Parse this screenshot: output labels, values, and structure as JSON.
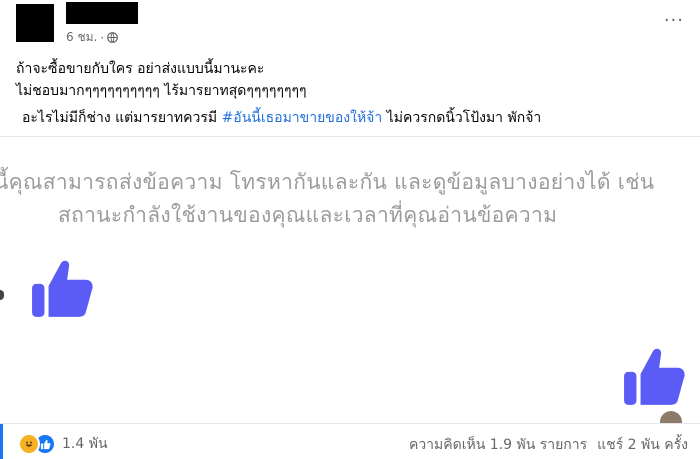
{
  "post": {
    "time": "6 ชม.",
    "separator": "·",
    "lines": {
      "line1": "ถ้าจะซื้อขายกับใคร อย่าส่งแบบนี้มานะคะ",
      "line2": "ไม่ชอบมากๆๆๆๆๆๆๆๆๆๆ ไร้มารยาทสุดๆๆๆๆๆๆๆๆ",
      "line3_before": "อะไรไม่มีก็ช่าง แต่มารยาทควรมี ",
      "line3_hashtag": "#อันนี้เธอมาขายของให้จ้า",
      "line3_after": " ไม่ควรกดนิ้วโป้งมา  พักจ้า"
    },
    "more_label": "···"
  },
  "media": {
    "text_line1": "นี้คุณสามารถส่งข้อความ โทรหากันและกัน และดูข้อมูลบางอย่างได้ เช่น",
    "text_line2": "สถานะกำลังใช้งานของคุณและเวลาที่คุณอ่านข้อความ",
    "thumb_color": "#5b5cf6",
    "icons": [
      "thumbs-up-icon",
      "thumbs-up-icon"
    ]
  },
  "footer": {
    "reaction_count": "1.4 พัน",
    "comments": "ความคิดเห็น 1.9 พัน รายการ",
    "shares": "แชร์ 2 พัน ครั้ง",
    "reaction_icons": [
      "haha-icon",
      "like-icon"
    ]
  },
  "colors": {
    "hashtag": "#216fdb",
    "secondary_text": "#65676b",
    "like_blue": "#1877f2"
  }
}
